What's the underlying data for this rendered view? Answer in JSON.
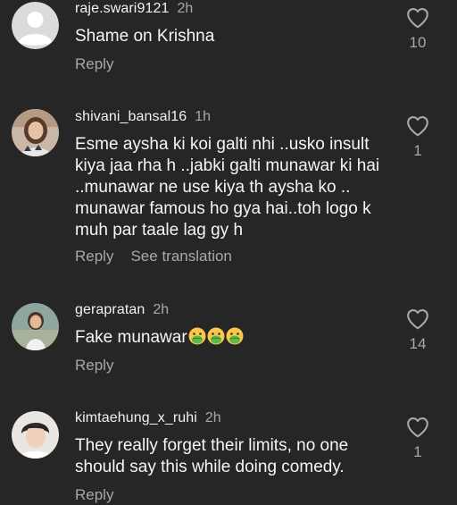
{
  "comments": [
    {
      "username": "raje.swari9121",
      "time": "2h",
      "text": "Shame on Krishna",
      "reply": "Reply",
      "likes": "10",
      "avatar": "default-avatar"
    },
    {
      "username": "shivani_bansal16",
      "time": "1h",
      "text": "Esme aysha ki koi galti nhi ..usko insult kiya jaa rha h ..jabki galti munawar ki hai ..munawar ne use kiya th aysha ko .. munawar famous ho gya hai..toh logo k muh par taale lag gy h",
      "reply": "Reply",
      "see_translation": "See translation",
      "likes": "1",
      "avatar": "girl-photo"
    },
    {
      "username": "gerapratan",
      "time": "2h",
      "text": "Fake munawar",
      "emojis": [
        "nauseated-face",
        "nauseated-face",
        "nauseated-face"
      ],
      "reply": "Reply",
      "likes": "14",
      "avatar": "child-photo"
    },
    {
      "username": "kimtaehung_x_ruhi",
      "time": "2h",
      "text": "They really forget their limits, no one should say this while doing comedy.",
      "reply": "Reply",
      "likes": "1",
      "avatar": "man-photo"
    }
  ],
  "icons": {
    "like": "heart-outline-icon",
    "emoji": "nauseated-face-emoji"
  },
  "colors": {
    "background": "#262626",
    "primary_text": "#f5f5f5",
    "secondary_text": "#a8a8a8"
  }
}
